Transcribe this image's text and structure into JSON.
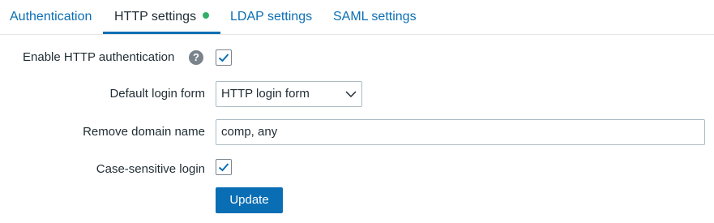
{
  "tabs": [
    {
      "label": "Authentication",
      "active": false
    },
    {
      "label": "HTTP settings",
      "active": true,
      "status_color": "#34af67"
    },
    {
      "label": "LDAP settings",
      "active": false
    },
    {
      "label": "SAML settings",
      "active": false
    }
  ],
  "form": {
    "enable_http_auth": {
      "label": "Enable HTTP authentication",
      "help_icon": "question-circle-icon",
      "help_glyph": "?",
      "checked": true
    },
    "default_login_form": {
      "label": "Default login form",
      "value": "HTTP login form"
    },
    "remove_domain_name": {
      "label": "Remove domain name",
      "value": "comp, any"
    },
    "case_sensitive_login": {
      "label": "Case-sensitive login",
      "checked": true
    },
    "update_button": "Update"
  },
  "colors": {
    "accent": "#0a6eb4",
    "text": "#1f2c33",
    "status_ok": "#34af67",
    "border": "#acbbc2"
  }
}
